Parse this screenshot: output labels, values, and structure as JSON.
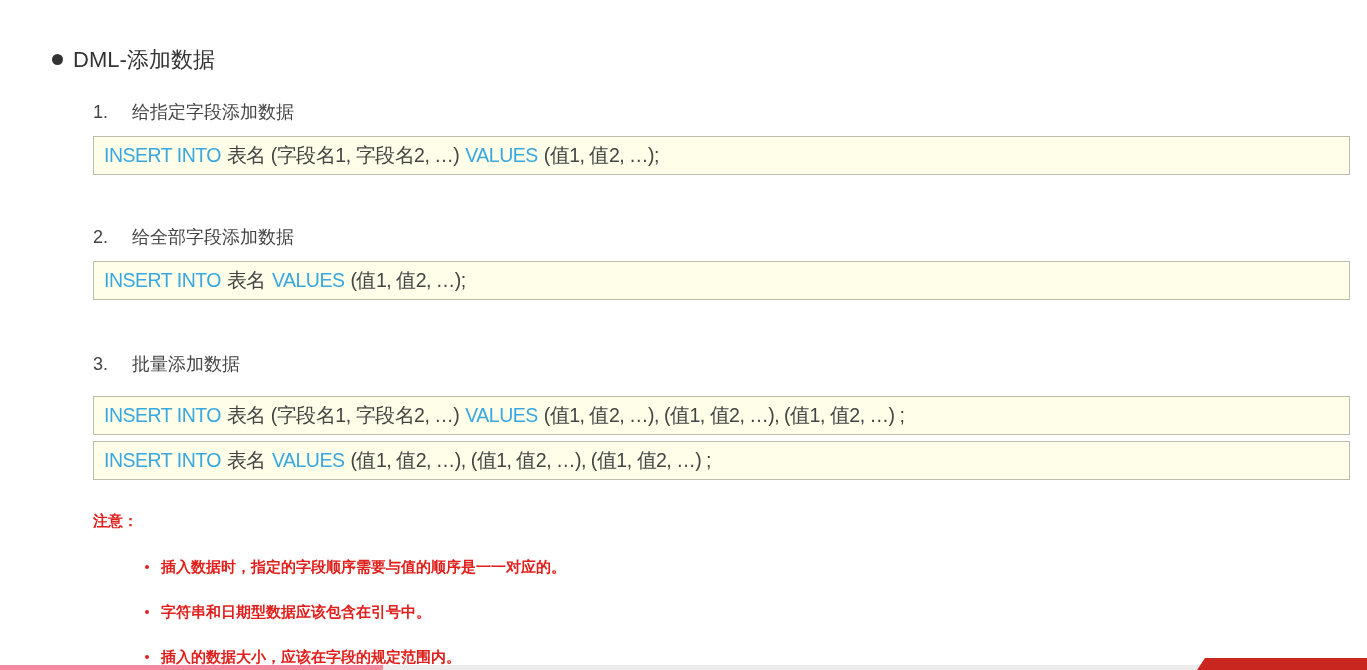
{
  "slide": {
    "title": "DML-添加数据",
    "sections": [
      {
        "number": "1.",
        "heading": "给指定字段添加数据",
        "code_lines": [
          [
            {
              "kind": "keyword",
              "text": "INSERT INTO"
            },
            {
              "kind": "text",
              "text": "表名 (字段名1, 字段名2, …)"
            },
            {
              "kind": "keyword",
              "text": "VALUES"
            },
            {
              "kind": "text",
              "text": "(值1, 值2, …);"
            }
          ]
        ]
      },
      {
        "number": "2.",
        "heading": "给全部字段添加数据",
        "code_lines": [
          [
            {
              "kind": "keyword",
              "text": "INSERT INTO"
            },
            {
              "kind": "text",
              "text": "表名"
            },
            {
              "kind": "keyword",
              "text": "VALUES"
            },
            {
              "kind": "text",
              "text": "(值1, 值2, …);"
            }
          ]
        ]
      },
      {
        "number": "3.",
        "heading": "批量添加数据",
        "code_lines": [
          [
            {
              "kind": "keyword",
              "text": "INSERT INTO"
            },
            {
              "kind": "text",
              "text": "表名 (字段名1, 字段名2, …)"
            },
            {
              "kind": "keyword",
              "text": "VALUES"
            },
            {
              "kind": "text",
              "text": "(值1, 值2, …), (值1, 值2, …), (值1, 值2, …) ;"
            }
          ],
          [
            {
              "kind": "keyword",
              "text": "INSERT INTO"
            },
            {
              "kind": "text",
              "text": "表名"
            },
            {
              "kind": "keyword",
              "text": "VALUES"
            },
            {
              "kind": "text",
              "text": "(值1, 值2, …), (值1, 值2, …), (值1, 值2, …) ;"
            }
          ]
        ]
      }
    ],
    "note_label": "注意：",
    "notes": [
      "插入数据时，指定的字段顺序需要与值的顺序是一一对应的。",
      "字符串和日期型数据应该包含在引号中。",
      "插入的数据大小，应该在字段的规定范围内。"
    ]
  },
  "player": {
    "progress": {
      "level": 0.28
    }
  }
}
